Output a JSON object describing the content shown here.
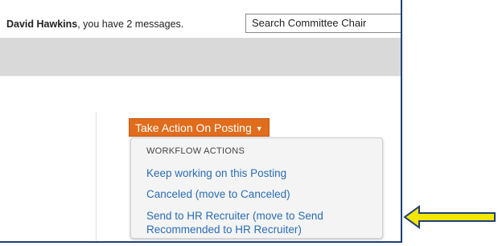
{
  "header": {
    "user_name": "David Hawkins",
    "message_text": ", you have 2 messages.",
    "role_select": "Search Committee Chair"
  },
  "action_button": {
    "label": "Take Action On Posting",
    "caret": "▼"
  },
  "menu": {
    "heading": "WORKFLOW ACTIONS",
    "items": [
      {
        "label": "Keep working on this Posting"
      },
      {
        "label": "Canceled (move to Canceled)"
      },
      {
        "label_line1": "Send to HR Recruiter (move to Send",
        "label_line2": "Recommended to HR Recruiter)"
      }
    ]
  },
  "annotation": {
    "arrow_color": "#f3e600",
    "arrow_outline": "#1f3f7a",
    "icon": "arrow-left-icon"
  },
  "colors": {
    "button": "#e06c1c",
    "link": "#2a6db3",
    "frame_border": "#1f3f7a"
  }
}
